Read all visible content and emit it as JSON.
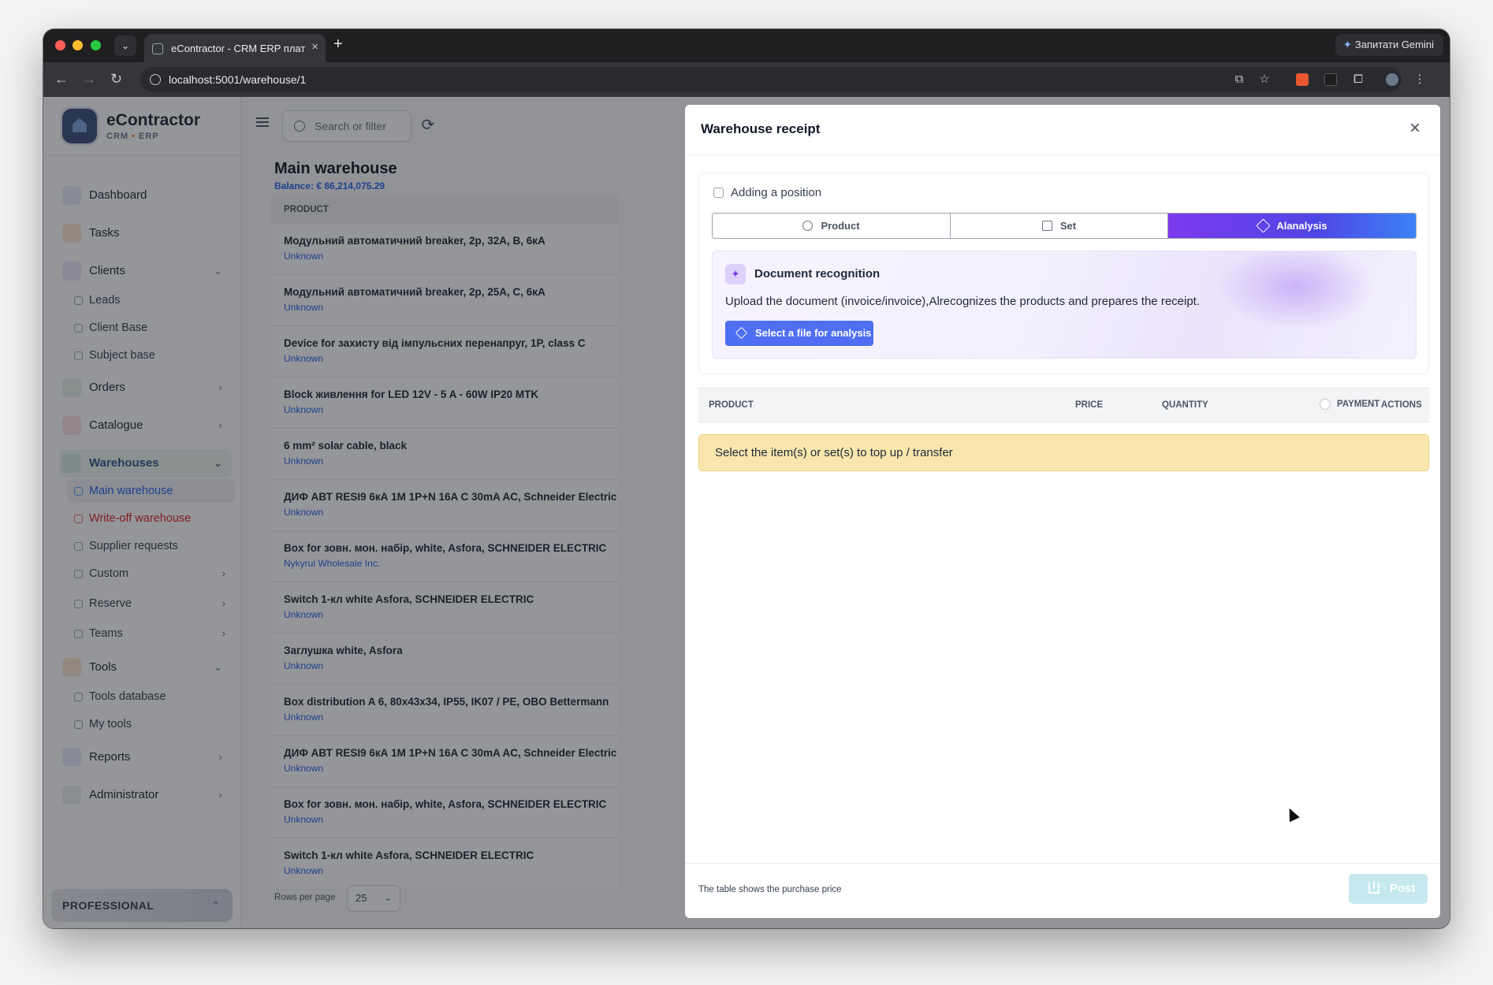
{
  "browser": {
    "tab_title": "eContractor - CRM ERP плат",
    "tab_menu_icon": "chevron-down-icon",
    "new_tab_label": "+",
    "tab_close_label": "×",
    "gemini_button_label": "Запитати Gemini",
    "url": "localhost:5001/warehouse/1"
  },
  "brand": {
    "name": "eContractor",
    "sub_left": "CRM",
    "sub_sep": "•",
    "sub_right": "ERP"
  },
  "sidebar": {
    "dashboard": "Dashboard",
    "tasks": "Tasks",
    "clients": "Clients",
    "leads": "Leads",
    "client_base": "Client Base",
    "subject_base": "Subject base",
    "orders": "Orders",
    "catalogue": "Catalogue",
    "warehouses": "Warehouses",
    "main_warehouse": "Main warehouse",
    "write_off_warehouse": "Write-off warehouse",
    "supplier_requests": "Supplier requests",
    "custom": "Custom",
    "reserve": "Reserve",
    "teams": "Teams",
    "tools": "Tools",
    "tools_database": "Tools database",
    "my_tools": "My tools",
    "reports": "Reports",
    "administrator": "Administrator",
    "plan": "PROFESSIONAL"
  },
  "main": {
    "search_placeholder": "Search or filter",
    "title": "Main warehouse",
    "balance": "Balance: € 86,214,075.29",
    "col_product": "PRODUCT",
    "rows_per_page_label": "Rows per page",
    "rows_per_page_value": "25",
    "products": [
      {
        "name": "Модульний автоматичний breaker, 2p, 32A, B, 6кА",
        "supplier": "Unknown"
      },
      {
        "name": "Модульний автоматичний breaker, 2p, 25A, C, 6кА",
        "supplier": "Unknown"
      },
      {
        "name": "Device for захисту від імпульсних перенапруг, 1P, class C",
        "supplier": "Unknown"
      },
      {
        "name": "Block живлення for LED 12V - 5 A - 60W IP20 MTK",
        "supplier": "Unknown"
      },
      {
        "name": "6 mm² solar cable, black",
        "supplier": "Unknown"
      },
      {
        "name": "ДИФ АВТ RESI9 6кА 1М 1P+N 16A C 30mA AC, Schneider Electric",
        "supplier": "Unknown"
      },
      {
        "name": "Box for зовн. мон. набір, white, Asfora, SCHNEIDER ELECTRIC",
        "supplier": "Nykyrui Wholesale Inc."
      },
      {
        "name": "Switch 1-кл white Asfora, SCHNEIDER ELECTRIC",
        "supplier": "Unknown"
      },
      {
        "name": "Заглушка white, Asfora",
        "supplier": "Unknown"
      },
      {
        "name": "Box distribution A 6, 80x43x34, IP55, IK07 / PE, OBO Bettermann",
        "supplier": "Unknown"
      },
      {
        "name": "ДИФ АВТ RESI9 6кА 1М 1P+N 16A C 30mA AC, Schneider Electric",
        "supplier": "Unknown"
      },
      {
        "name": "Box for зовн. мон. набір, white, Asfora, SCHNEIDER ELECTRIC",
        "supplier": "Unknown"
      },
      {
        "name": "Switch 1-кл white Asfora, SCHNEIDER ELECTRIC",
        "supplier": "Unknown"
      }
    ]
  },
  "dialog": {
    "title": "Warehouse receipt",
    "section_title": "Adding a position",
    "tabs": {
      "product": "Product",
      "set": "Set",
      "ai": "Alanalysis"
    },
    "recognition": {
      "title": "Document recognition",
      "description": "Upload the document (invoice/invoice),Alrecognizes the products and prepares the receipt.",
      "button": "Select a file for analysis"
    },
    "table": {
      "product": "PRODUCT",
      "price": "PRICE",
      "quantity": "QUANTITY",
      "payment": "PAYMENT",
      "actions": "ACTIONS"
    },
    "empty_message": "Select the item(s) or set(s) to top up / transfer",
    "footer_note": "The table shows the purchase price",
    "post_button": "Post"
  },
  "colors": {
    "accent_blue": "#2563eb",
    "ai_gradient_start": "#7c3aed",
    "ai_gradient_end": "#3b82f6",
    "alert_bg": "#f8e6ad",
    "post_disabled": "#c5e9ee"
  }
}
